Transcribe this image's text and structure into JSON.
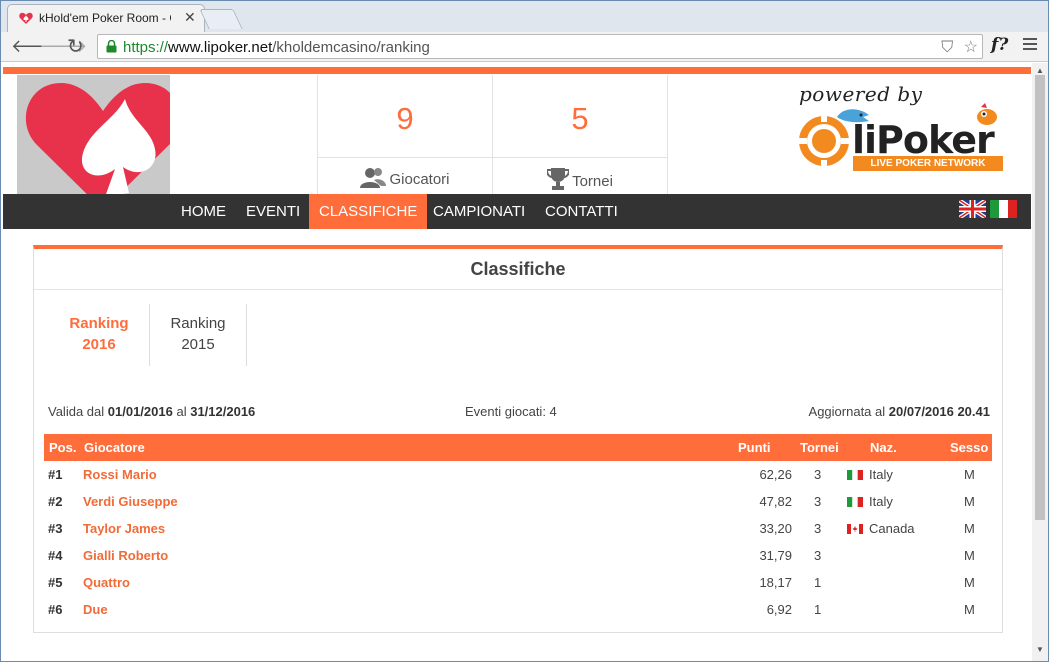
{
  "browser": {
    "tab_title": "kHold'em Poker Room - C",
    "tab_close": "✕",
    "url_scheme": "https://",
    "url_host": "www.lipoker.net",
    "url_path": "/kholdemcasino/ranking",
    "ext_label": "f?"
  },
  "stats": [
    {
      "value": "9",
      "label": "Giocatori",
      "icon": "users-icon"
    },
    {
      "value": "5",
      "label": "Tornei",
      "icon": "trophy-icon"
    }
  ],
  "brand": {
    "powered": "powered by",
    "name": "liPoker",
    "tagline": "LIVE POKER NETWORK"
  },
  "nav": {
    "items": [
      "HOME",
      "EVENTI",
      "CLASSIFICHE",
      "CAMPIONATI",
      "CONTATTI"
    ],
    "active_index": 2
  },
  "languages": [
    "English flag",
    "Italian flag"
  ],
  "panel": {
    "title": "Classifiche",
    "tabs": [
      {
        "line1": "Ranking",
        "line2": "2016",
        "active": true
      },
      {
        "line1": "Ranking",
        "line2": "2015",
        "active": false
      }
    ],
    "valid_prefix": "Valida dal",
    "valid_from": "01/01/2016",
    "valid_mid": "al",
    "valid_to": "31/12/2016",
    "events_played": "Eventi giocati: 4",
    "updated_prefix": "Aggiornata al",
    "updated_at": "20/07/2016 20.41"
  },
  "table": {
    "headers": {
      "pos": "Pos.",
      "player": "Giocatore",
      "points": "Punti",
      "tournaments": "Tornei",
      "nation": "Naz.",
      "gender": "Sesso"
    },
    "rows": [
      {
        "pos": "#1",
        "player": "Rossi Mario",
        "points": "62,26",
        "tournaments": "3",
        "nation": "Italy",
        "flag": "it",
        "gender": "M"
      },
      {
        "pos": "#2",
        "player": "Verdi Giuseppe",
        "points": "47,82",
        "tournaments": "3",
        "nation": "Italy",
        "flag": "it",
        "gender": "M"
      },
      {
        "pos": "#3",
        "player": "Taylor James",
        "points": "33,20",
        "tournaments": "3",
        "nation": "Canada",
        "flag": "ca",
        "gender": "M"
      },
      {
        "pos": "#4",
        "player": "Gialli Roberto",
        "points": "31,79",
        "tournaments": "3",
        "nation": "",
        "flag": "",
        "gender": "M"
      },
      {
        "pos": "#5",
        "player": "Quattro",
        "points": "18,17",
        "tournaments": "1",
        "nation": "",
        "flag": "",
        "gender": "M"
      },
      {
        "pos": "#6",
        "player": "Due",
        "points": "6,92",
        "tournaments": "1",
        "nation": "",
        "flag": "",
        "gender": "M"
      }
    ]
  },
  "colors": {
    "accent": "#ff6d3b",
    "navbar": "#333333",
    "player_link": "#f06b38",
    "logo_red": "#e8314a"
  }
}
